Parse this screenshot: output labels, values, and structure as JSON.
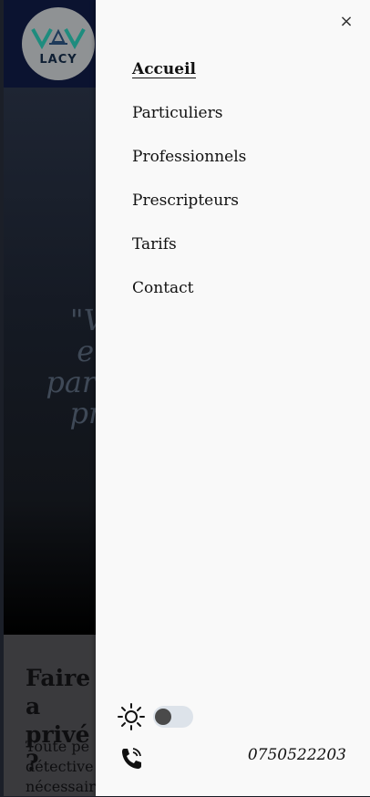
{
  "background": {
    "logo_text": "LACY",
    "hero_quote_lines": [
      "\"Vo",
      "en",
      "parten",
      "pro"
    ],
    "section_title": "Faire a privé ?",
    "section_text": "Toute pe détective nécessair"
  },
  "drawer": {
    "close_label": "×",
    "nav": [
      {
        "label": "Accueil",
        "active": true
      },
      {
        "label": "Particuliers"
      },
      {
        "label": "Professionnels"
      },
      {
        "label": "Prescripteurs"
      },
      {
        "label": "Tarifs"
      },
      {
        "label": "Contact"
      }
    ],
    "theme_toggle": {
      "icon": "sun-icon",
      "state": "off"
    },
    "phone": {
      "icon": "phone-icon",
      "number": "0750522203"
    }
  },
  "colors": {
    "drawer_bg": "#f9f9f9",
    "header_bg": "#0b1330",
    "logo_teal": "#1e8c7e"
  }
}
